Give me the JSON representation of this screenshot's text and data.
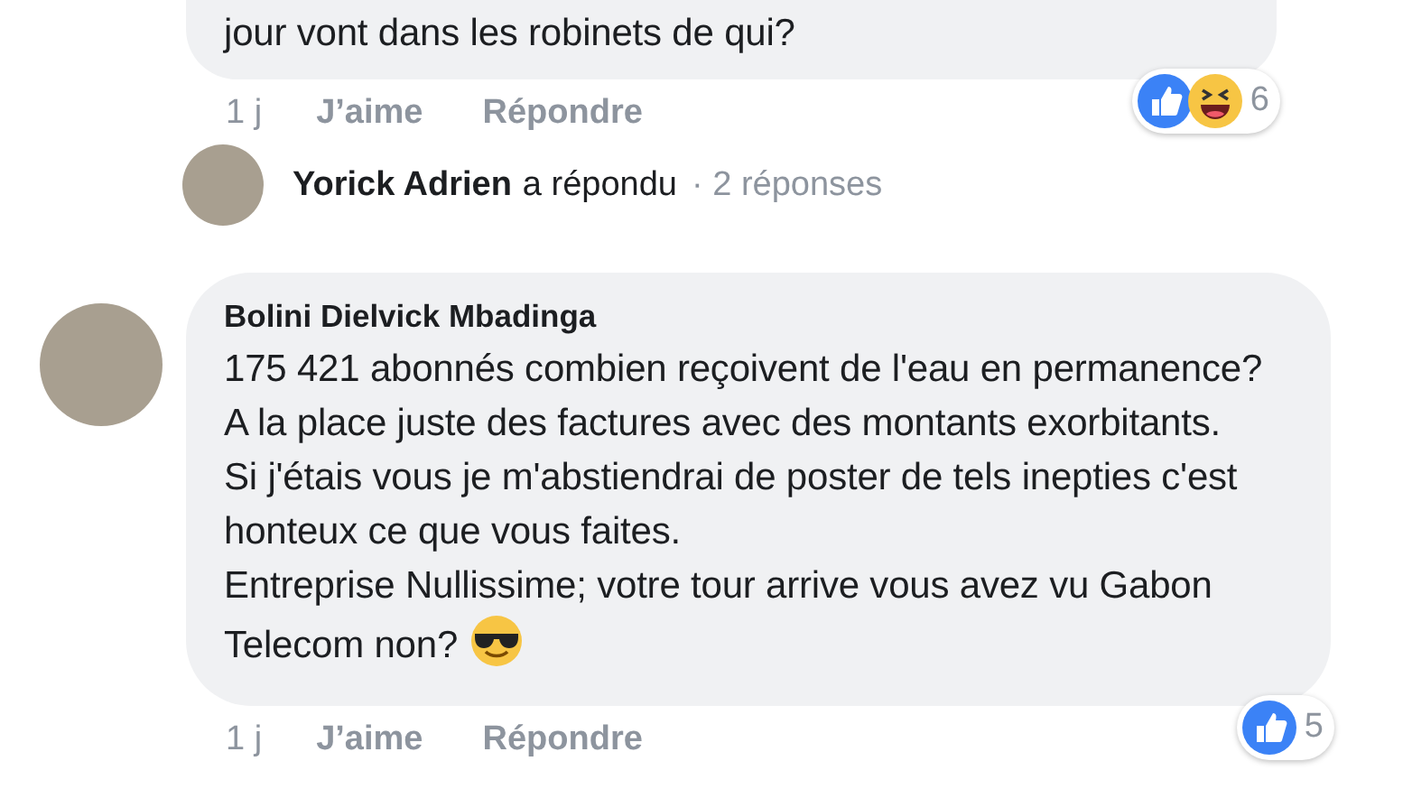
{
  "comments": [
    {
      "text": "jour vont dans les robinets de qui?",
      "time": "1 j",
      "actions": [
        "J’aime",
        "Répondre"
      ],
      "reactions": {
        "icons": [
          {
            "kind": "like"
          },
          {
            "kind": "haha"
          }
        ],
        "count": "6"
      },
      "reply_summary": {
        "name": "Yorick Adrien",
        "verb": "a répondu",
        "count": "· 2 réponses"
      }
    },
    {
      "author": "Bolini Dielvick Mbadinga",
      "text": "175 421 abonnés combien reçoivent de l'eau en permanence? A la place juste des factures avec des montants exorbitants.\nSi j'étais vous je m'abstiendrai de poster de tels inepties c'est honteux ce que vous faites.\nEntreprise Nullissime; votre tour arrive vous avez vu Gabon Telecom non?",
      "emoji": {
        "kind": "sunglasses"
      },
      "time": "1 j",
      "actions": [
        "J’aime",
        "Répondre"
      ],
      "reactions": {
        "icons": [
          {
            "kind": "like"
          }
        ],
        "count": "5"
      }
    }
  ]
}
